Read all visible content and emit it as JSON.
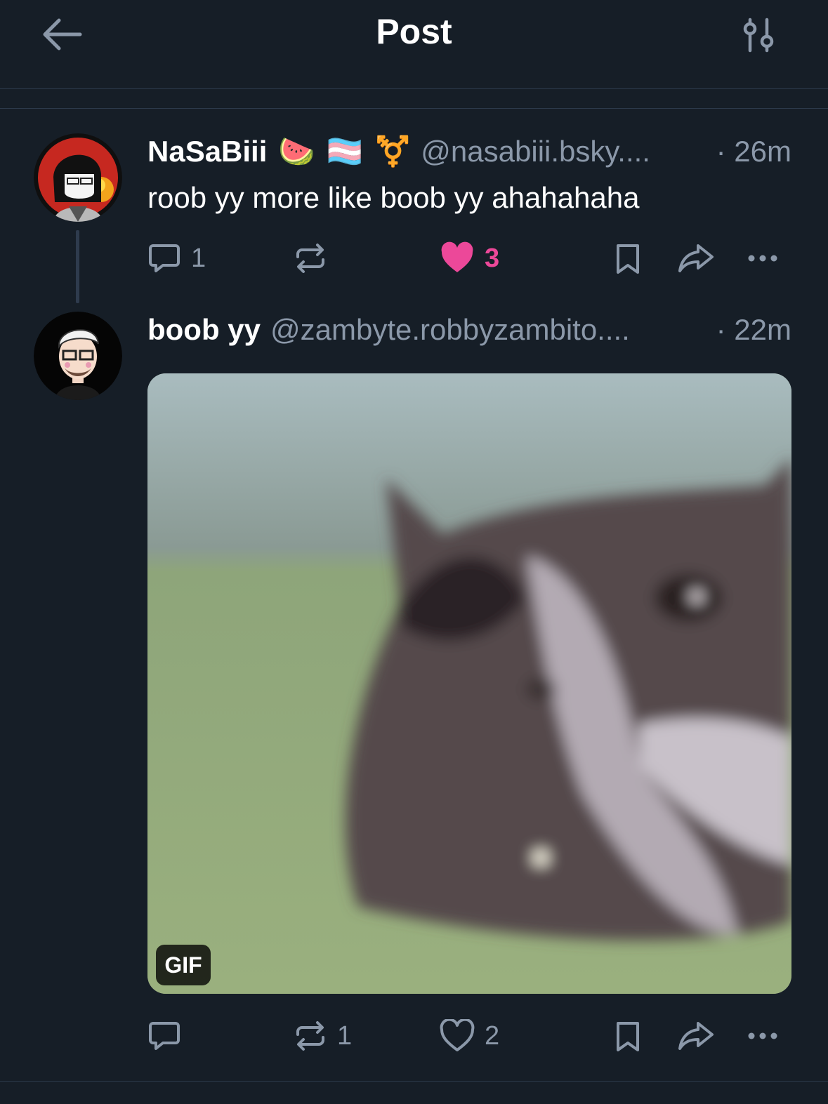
{
  "header": {
    "title": "Post"
  },
  "posts": [
    {
      "name": "NaSaBiii",
      "emojis": [
        "🍉",
        "🏳️‍⚧️",
        "⚧️"
      ],
      "handle": "@nasabiii.bsky....",
      "time": "· 26m",
      "text": "roob yy more like boob yy ahahahaha",
      "reply_count": "1",
      "repost_count": "",
      "like_count": "3",
      "liked": true
    },
    {
      "name": "boob yy",
      "handle": "@zambyte.robbyzambito....",
      "time": "· 22m",
      "media": {
        "badge": "GIF"
      },
      "reply_count": "",
      "repost_count": "1",
      "like_count": "2",
      "liked": false
    }
  ],
  "colors": {
    "background": "#161e27",
    "muted": "#8b98a9",
    "like": "#ec4899"
  }
}
